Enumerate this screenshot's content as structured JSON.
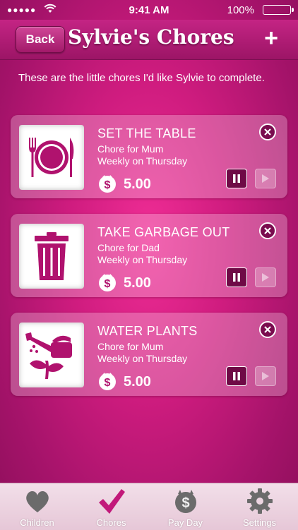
{
  "status_bar": {
    "signal": "●●●●●",
    "time": "9:41 AM",
    "battery": "100%"
  },
  "nav": {
    "back_label": "Back",
    "title": "Sylvie's Chores",
    "add_label": "+"
  },
  "intro": "These are the little chores I'd like Sylvie to complete.",
  "chores": [
    {
      "name": "SET THE TABLE",
      "for": "Chore for Mum",
      "frequency": "Weekly on Thursday",
      "amount": "5.00",
      "icon": "plate-cutlery-icon"
    },
    {
      "name": "TAKE GARBAGE OUT",
      "for": "Chore for Dad",
      "frequency": "Weekly on Thursday",
      "amount": "5.00",
      "icon": "trash-can-icon"
    },
    {
      "name": "WATER PLANTS",
      "for": "Chore for Mum",
      "frequency": "Weekly on Thursday",
      "amount": "5.00",
      "icon": "watering-can-icon"
    }
  ],
  "tabs": [
    {
      "label": "Children",
      "icon": "heart-icon"
    },
    {
      "label": "Chores",
      "icon": "checkmark-icon",
      "active": true
    },
    {
      "label": "Pay Day",
      "icon": "piggy-bank-icon"
    },
    {
      "label": "Settings",
      "icon": "gear-icon"
    }
  ],
  "colors": {
    "accent": "#c2187a",
    "icon": "#b0126e",
    "button_dark": "#6f0a46"
  }
}
